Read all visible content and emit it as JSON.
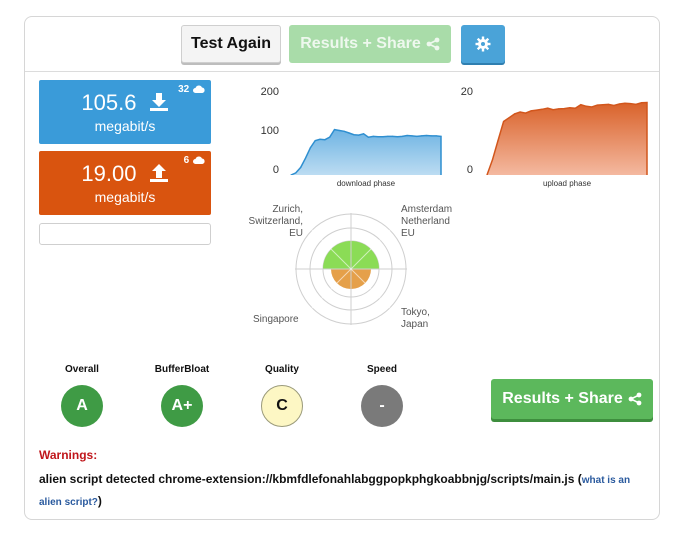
{
  "toolbar": {
    "test_again_label": "Test Again",
    "results_share_label": "Results + Share",
    "settings_icon": "gear-icon"
  },
  "download": {
    "value": "105.6",
    "unit": "megabit/s",
    "connections": "32",
    "icon": "download-icon",
    "color": "#3a9bd9"
  },
  "upload": {
    "value": "19.00",
    "unit": "megabit/s",
    "connections": "6",
    "icon": "upload-icon",
    "color": "#d9540f"
  },
  "charts": {
    "download_ticks": [
      "200",
      "100",
      "0"
    ],
    "download_caption": "download phase",
    "upload_ticks": [
      "20",
      "0"
    ],
    "upload_caption": "upload phase"
  },
  "chart_data": [
    {
      "type": "area",
      "title": "",
      "xlabel": "download phase",
      "ylabel": "",
      "ylim": [
        0,
        200
      ],
      "series": [
        {
          "values": [
            0,
            5,
            18,
            40,
            65,
            82,
            85,
            84,
            90,
            108,
            106,
            104,
            100,
            96,
            95,
            98,
            90,
            92,
            91,
            91,
            92,
            92,
            91,
            92,
            94,
            93,
            92,
            93,
            94,
            93,
            93,
            92
          ]
        }
      ]
    },
    {
      "type": "area",
      "title": "",
      "xlabel": "upload phase",
      "ylabel": "",
      "ylim": [
        0,
        22
      ],
      "series": [
        {
          "values": [
            0,
            4,
            9,
            14,
            15,
            16,
            16.5,
            16.2,
            16.8,
            17,
            17.2,
            17.5,
            17.1,
            17.3,
            17.4,
            17.6,
            17.5,
            18.4,
            18.0,
            17.8,
            18.3,
            18.4,
            18.5,
            18.2,
            18.6,
            18.8,
            18.7,
            18.5,
            18.9,
            19.0
          ]
        }
      ]
    }
  ],
  "servers": {
    "zurich": "Zurich,\nSwitzerland,\nEU",
    "amsterdam": "Amsterdam\nNetherland\nEU",
    "singapore": "Singapore",
    "tokyo": "Tokyo,\nJapan"
  },
  "grades": [
    {
      "title": "Overall",
      "grade": "A"
    },
    {
      "title": "BufferBloat",
      "grade": "A+"
    },
    {
      "title": "Quality",
      "grade": "C"
    },
    {
      "title": "Speed",
      "grade": "-"
    }
  ],
  "results_share_big_label": "Results + Share",
  "warnings": {
    "title": "Warnings:",
    "text": "alien script detected chrome-extension://kbmfdlefonahlabggpopkphgkoabbnjg/scripts/main.js (",
    "link": "what is an alien script?",
    "after": ")"
  }
}
